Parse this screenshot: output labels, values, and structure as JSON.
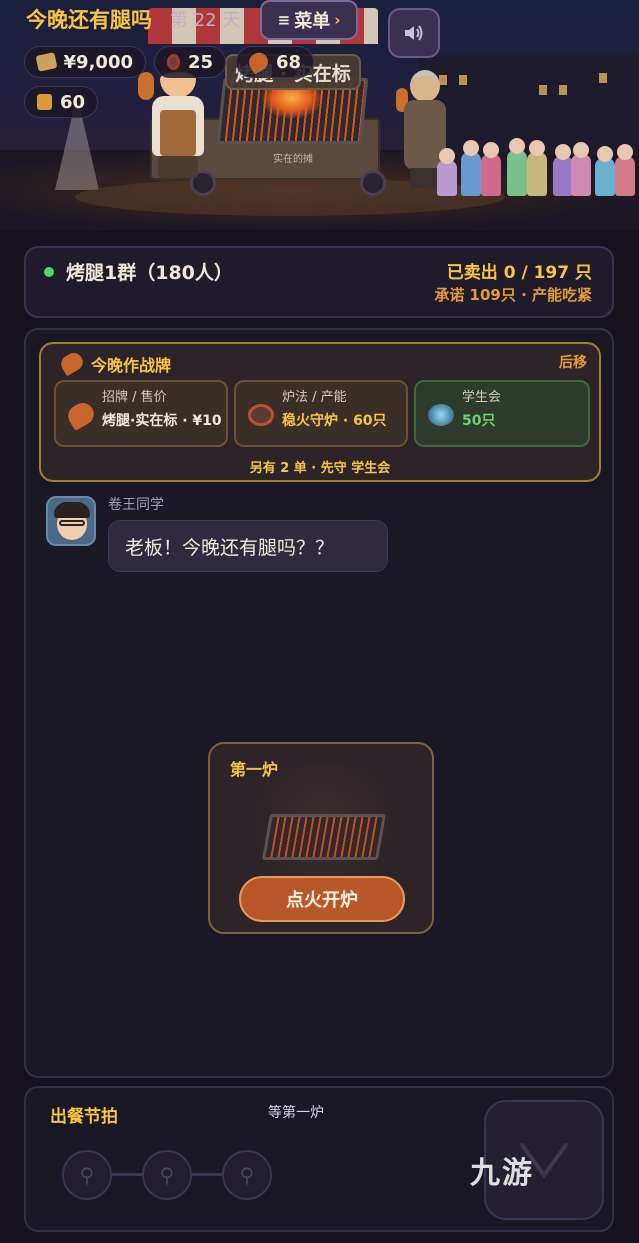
{
  "header": {
    "title": "今晚还有腿吗",
    "day_label": "第 22 天",
    "menu_label": "菜单",
    "cart_sign": "烤腿 · 实在标",
    "cart_sub": "实在的摊"
  },
  "resources": {
    "money": "¥9,000",
    "grill_count": "25",
    "leg_count": "68",
    "box_count": "60"
  },
  "group": {
    "name": "烤腿1群（180人）",
    "sold": "已卖出 0 / 197 只",
    "promise": "承诺 109只 · 产能吃紧"
  },
  "strategy": {
    "title": "今晚作战牌",
    "defer": "后移",
    "slots": [
      {
        "label": "招牌 / 售价",
        "value": "烤腿·实在标 · ¥10"
      },
      {
        "label": "炉法 / 产能",
        "value": "稳火守炉 · 60只"
      },
      {
        "label": "学生会",
        "value": "50只"
      }
    ],
    "footer": "另有 2 单 · 先守 学生会"
  },
  "chat": {
    "sender": "卷王同学",
    "message": "老板！今晚还有腿吗？？"
  },
  "stove": {
    "title": "第一炉",
    "action": "点火开炉"
  },
  "rhythm": {
    "title": "出餐节拍",
    "status": "等第一炉"
  },
  "watermark": "九游",
  "colors": {
    "accent_gold": "#f7c444",
    "accent_orange": "#e59a3a",
    "online_green": "#4cd964",
    "button_orange": "#b8582a"
  }
}
